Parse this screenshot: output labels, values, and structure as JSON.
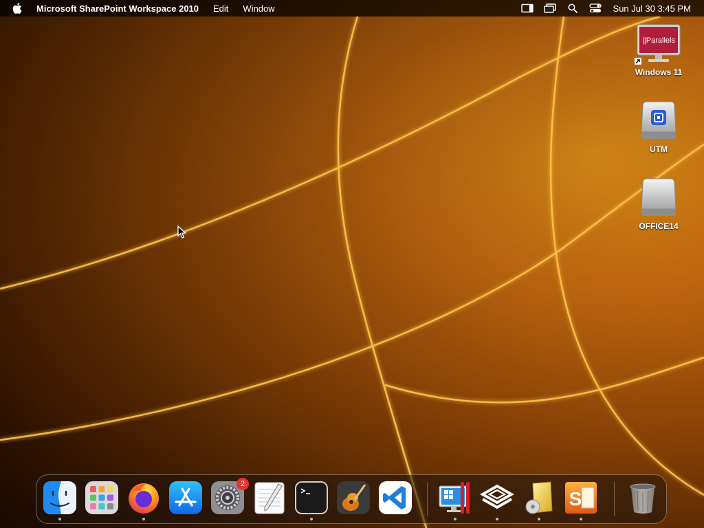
{
  "menubar": {
    "app_name": "Microsoft SharePoint Workspace 2010",
    "menus": [
      "Edit",
      "Window"
    ],
    "status_icons": [
      "stage-manager-icon",
      "screen-mirroring-icon",
      "spotlight-search-icon",
      "control-center-icon"
    ],
    "clock": "Sun Jul 30  3:45 PM"
  },
  "desktop_icons": [
    {
      "label": "Windows 11",
      "icon": "parallels-vm-icon",
      "logo_text": "||Parallels"
    },
    {
      "label": "UTM",
      "icon": "utm-disk-icon"
    },
    {
      "label": "OFFICE14",
      "icon": "external-disk-icon"
    }
  ],
  "dock": {
    "items": [
      {
        "name": "Finder",
        "icon": "finder-icon",
        "running": true
      },
      {
        "name": "Launchpad",
        "icon": "launchpad-icon",
        "running": false
      },
      {
        "name": "Firefox",
        "icon": "firefox-icon",
        "running": true
      },
      {
        "name": "App Store",
        "icon": "app-store-icon",
        "running": false
      },
      {
        "name": "System Settings",
        "icon": "system-settings-icon",
        "running": false,
        "badge": "2"
      },
      {
        "name": "TextEdit",
        "icon": "textedit-icon",
        "running": false
      },
      {
        "name": "Terminal",
        "icon": "terminal-icon",
        "running": true
      },
      {
        "name": "GarageBand",
        "icon": "garageband-icon",
        "running": false
      },
      {
        "name": "Visual Studio Code",
        "icon": "vscode-icon",
        "running": false
      },
      {
        "name": "Parallels Desktop",
        "icon": "parallels-desktop-icon",
        "running": true
      },
      {
        "name": "UTM",
        "icon": "utm-icon",
        "running": true
      },
      {
        "name": "Office Installer",
        "icon": "office-installer-icon",
        "running": true
      },
      {
        "name": "SharePoint Workspace",
        "icon": "sharepoint-workspace-icon",
        "running": true
      },
      {
        "name": "Trash",
        "icon": "trash-icon",
        "running": false
      }
    ]
  },
  "colors": {
    "wallpaper_accent": "#f09a1a",
    "badge": "#e8322c"
  }
}
